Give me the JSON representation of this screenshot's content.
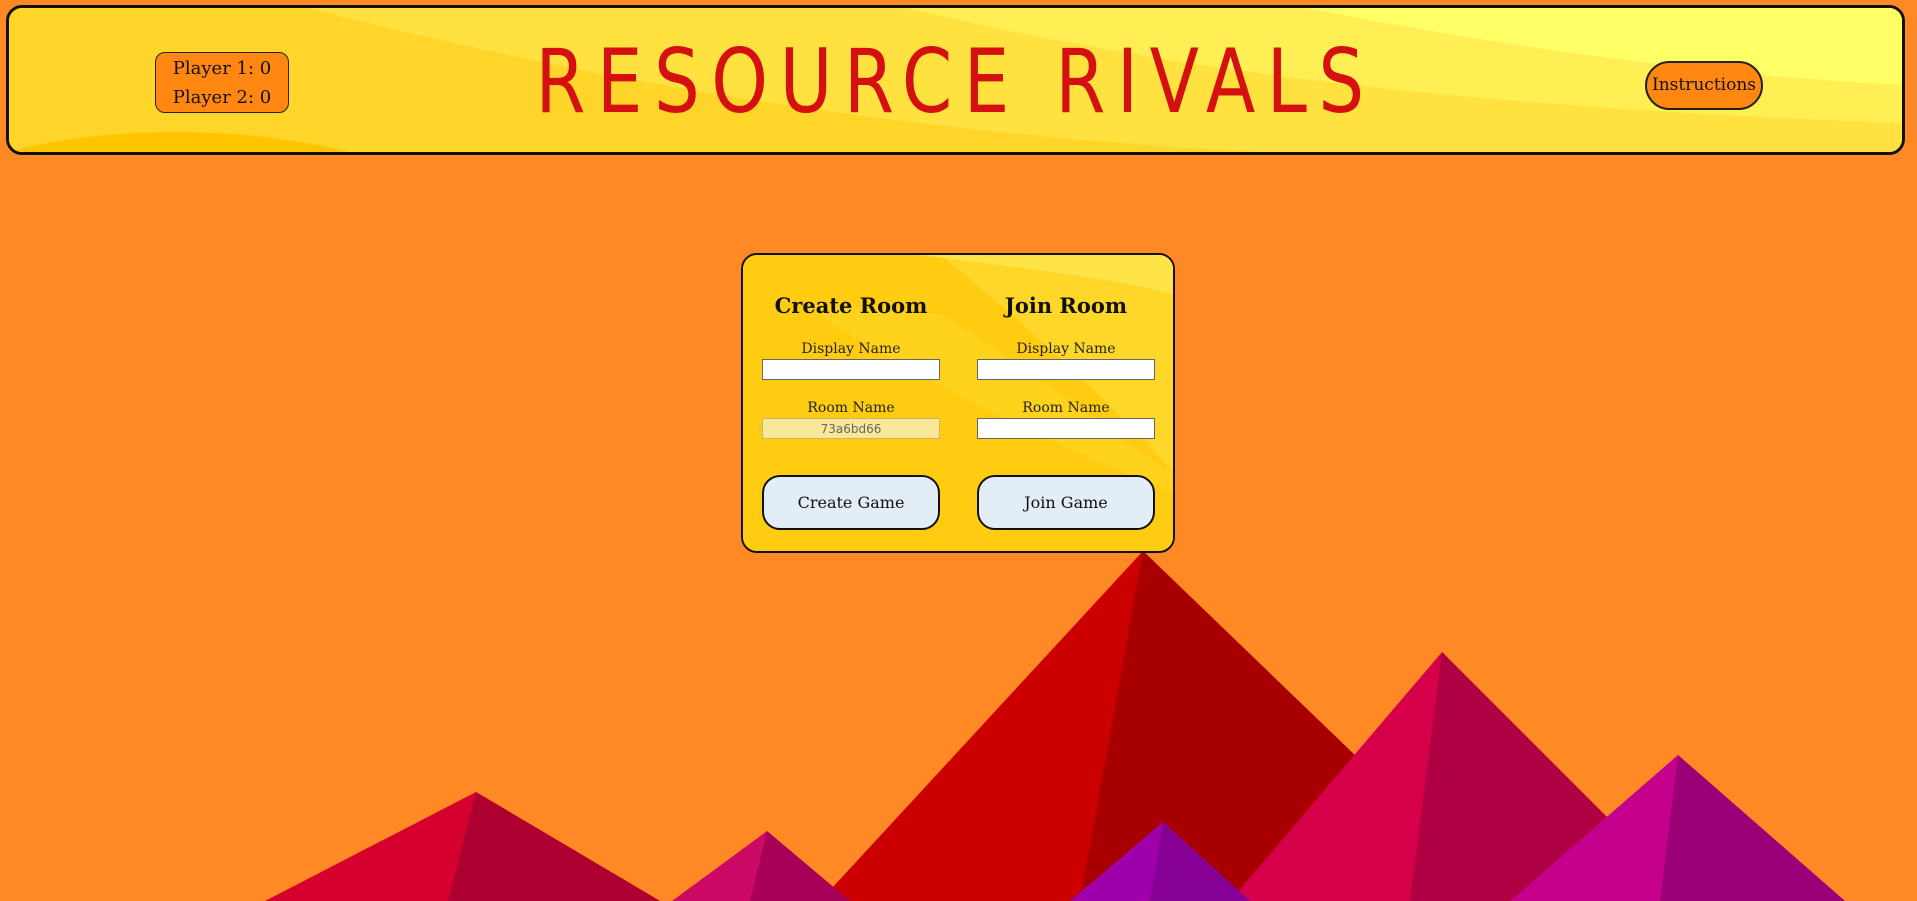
{
  "header": {
    "title": "RESOURCE RIVALS",
    "scores": [
      "Player 1: 0",
      "Player 2: 0"
    ],
    "instructions_label": "Instructions"
  },
  "create_room": {
    "heading": "Create Room",
    "display_name_label": "Display Name",
    "display_name_value": "",
    "room_name_label": "Room Name",
    "room_name_value": "73a6bd66",
    "button_label": "Create Game"
  },
  "join_room": {
    "heading": "Join Room",
    "display_name_label": "Display Name",
    "display_name_value": "",
    "room_name_label": "Room Name",
    "room_name_value": "",
    "button_label": "Join Game"
  },
  "colors": {
    "background": "#ff8a25",
    "header": "#ffd52a",
    "title": "#d51010",
    "accent_button": "#ff8712",
    "panel": "#ffcc11",
    "action_button": "#e3edf6"
  }
}
